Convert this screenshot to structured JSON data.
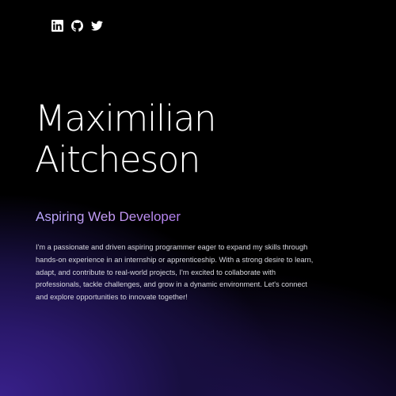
{
  "social": {
    "links": [
      {
        "name": "linkedin-icon"
      },
      {
        "name": "github-icon"
      },
      {
        "name": "twitter-icon"
      }
    ]
  },
  "hero": {
    "first_name": "Maximilian",
    "last_name": "Aitcheson",
    "subtitle": "Aspiring Web Developer",
    "bio": "I'm a passionate and driven aspiring programmer eager to expand my skills through hands-on experience in an internship or apprenticeship. With a strong desire to learn, adapt, and contribute to real-world projects, I'm excited to collaborate with professionals, tackle challenges, and grow in a dynamic environment. Let's connect and explore opportunities to innovate together!"
  },
  "colors": {
    "background": "#000000",
    "gradient_purple": "#38208a",
    "subtitle_start": "#b9a8ff",
    "subtitle_end": "#b37ff0"
  }
}
